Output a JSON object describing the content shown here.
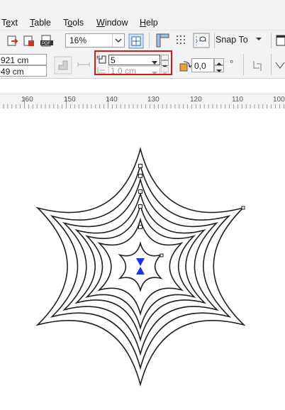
{
  "menubar": {
    "items": [
      {
        "label": "Text",
        "underline": "e"
      },
      {
        "label": "Table",
        "underline": "T"
      },
      {
        "label": "Tools",
        "underline": "o"
      },
      {
        "label": "Window",
        "underline": "W"
      },
      {
        "label": "Help",
        "underline": "H"
      }
    ]
  },
  "toolbar": {
    "zoom_value": "16%",
    "snap_to_label": "Snap To"
  },
  "property_bar": {
    "width_value": "921 cm",
    "height_value": "49 cm",
    "contour_steps_value": "5",
    "contour_offset_value": "1.0 cm",
    "angle_value": "0,0",
    "angle_unit": "°"
  },
  "ruler": {
    "labels": [
      "160",
      "150",
      "140",
      "130",
      "120",
      "110",
      "100"
    ]
  },
  "colors": {
    "highlight_border": "#d21a1a",
    "center_marker": "#1a33e6",
    "contour_stroke": "#231f20"
  },
  "icons": [
    "export-icon",
    "publish-icon",
    "pdf-icon",
    "full-screen-icon",
    "rulers-icon",
    "grid-icon",
    "guidelines-icon",
    "options-icon",
    "contour-steps-icon",
    "contour-offset-icon",
    "rotate-icon",
    "copy-properties-icon",
    "clear-contour-icon"
  ]
}
